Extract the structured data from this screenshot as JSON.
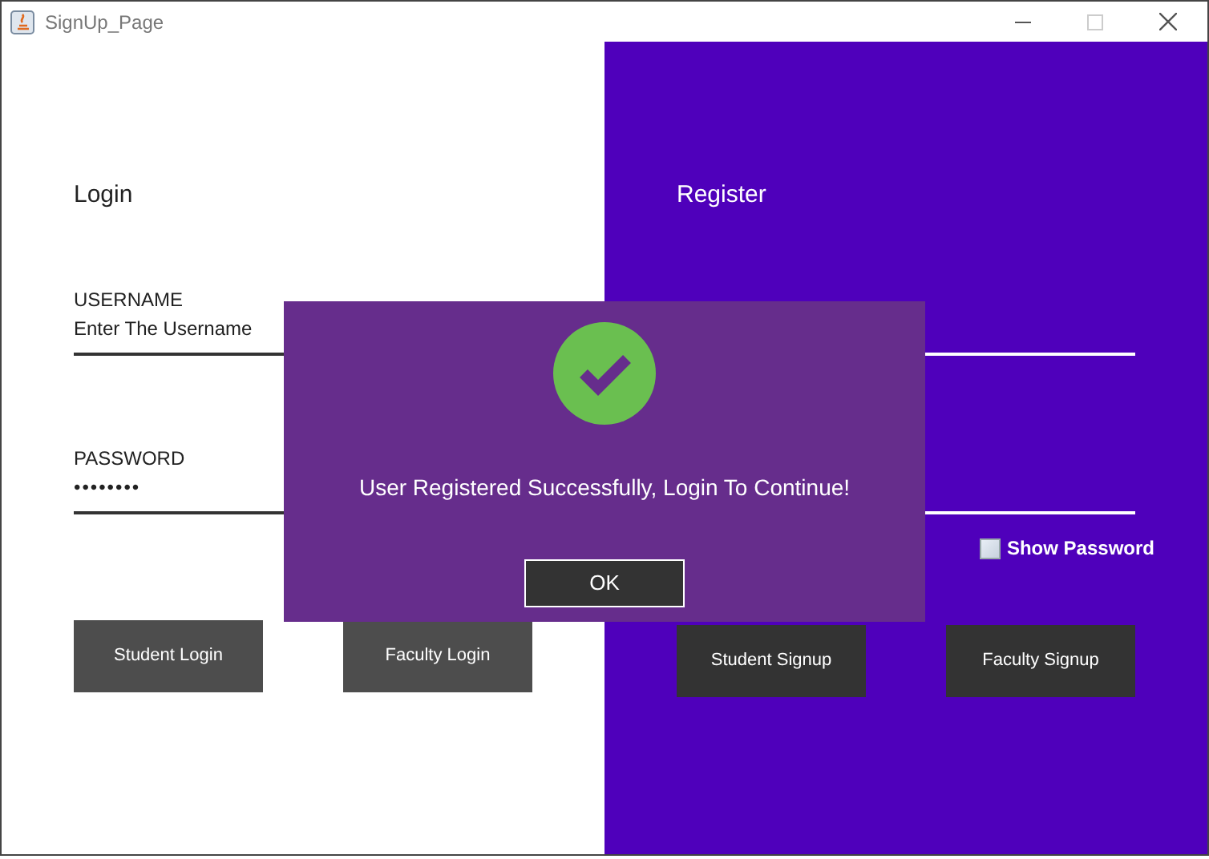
{
  "window": {
    "title": "SignUp_Page"
  },
  "login": {
    "heading": "Login",
    "username": {
      "label": "USERNAME",
      "value": "Enter The Username"
    },
    "password": {
      "label": "PASSWORD",
      "value": "••••••••"
    },
    "buttons": [
      "Student Login",
      "Faculty Login"
    ]
  },
  "register": {
    "heading": "Register",
    "show_password": {
      "label": "Show Password",
      "checked": false
    },
    "buttons": [
      "Student Signup",
      "Faculty Signup"
    ]
  },
  "dialog": {
    "message": "User Registered Successfully, Login To Continue!",
    "button": "OK"
  }
}
